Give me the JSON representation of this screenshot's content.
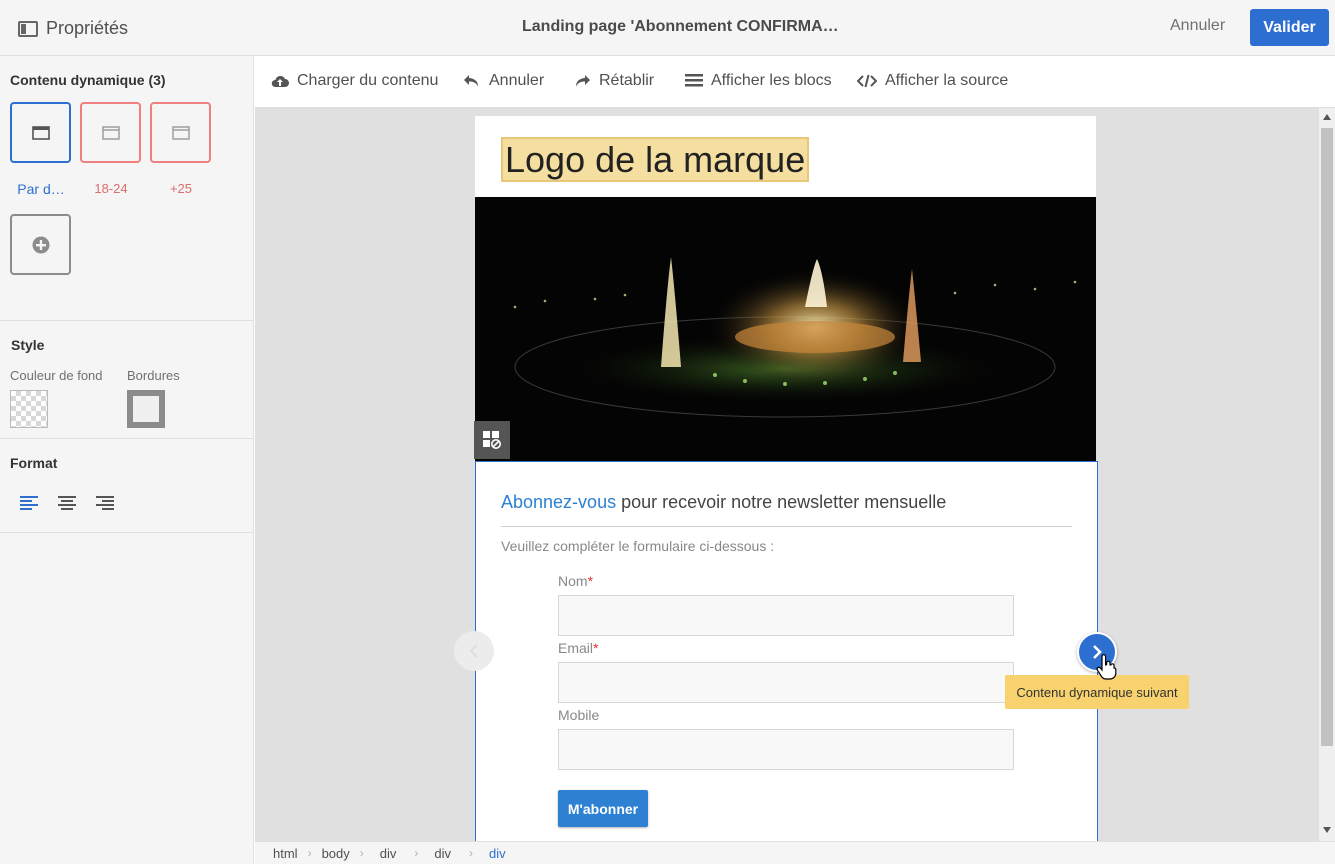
{
  "topbar": {
    "panel_title": "Propriétés",
    "document_title": "Landing page 'Abonnement CONFIRMA…",
    "cancel_label": "Annuler",
    "validate_label": "Valider"
  },
  "left_panel": {
    "dynamic_content_title": "Contenu dynamique (3)",
    "variants": [
      {
        "label": "Par d…",
        "state": "selected"
      },
      {
        "label": "18-24",
        "state": "variant"
      },
      {
        "label": "+25",
        "state": "variant"
      }
    ],
    "style_title": "Style",
    "background_label": "Couleur de fond",
    "borders_label": "Bordures",
    "format_title": "Format",
    "align_icons": [
      "align-left-icon",
      "align-center-icon",
      "align-right-icon"
    ]
  },
  "toolbar": {
    "upload_label": "Charger du contenu",
    "undo_label": "Annuler",
    "redo_label": "Rétablir",
    "blocks_label": "Afficher les blocs",
    "source_label": "Afficher la source"
  },
  "email": {
    "logo_text": "Logo de la marque",
    "headline_link": "Abonnez-vous",
    "headline_rest": " pour recevoir notre newsletter mensuelle",
    "intro": "Veuillez compléter le formulaire ci-dessous :",
    "fields": [
      {
        "label": "Nom",
        "required": "*",
        "value": ""
      },
      {
        "label": "Email",
        "required": "*",
        "value": ""
      },
      {
        "label": "Mobile",
        "required": "",
        "value": ""
      }
    ],
    "submit_label": "M'abonner"
  },
  "tooltip": "Contenu dynamique suivant",
  "breadcrumb": [
    "html",
    "body",
    "div",
    "div",
    "div"
  ],
  "colors": {
    "accent": "#2d6fd1",
    "variant_border": "#f08080",
    "tooltip_bg": "#f7d26e"
  }
}
